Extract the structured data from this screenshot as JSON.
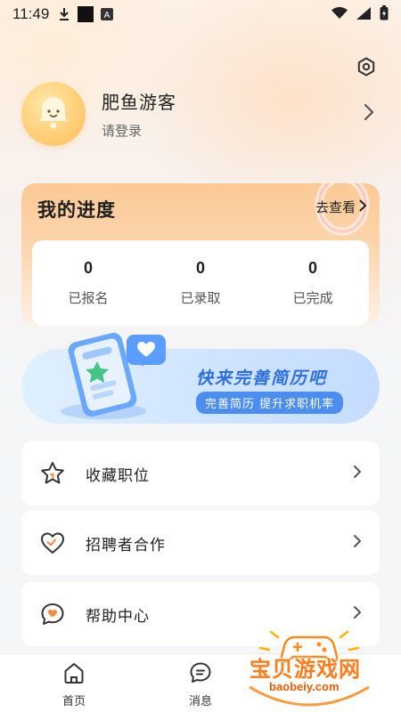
{
  "status_bar": {
    "time": "11:49",
    "icons": [
      "download-icon",
      "media-icon",
      "a-notification-icon",
      "wifi-icon",
      "signal-icon",
      "battery-icon"
    ]
  },
  "profile": {
    "name": "肥鱼游客",
    "subtitle": "请登录",
    "avatar_icon": "bell-icon"
  },
  "progress": {
    "title": "我的进度",
    "link_label": "去查看",
    "stats": [
      {
        "value": "0",
        "label": "已报名"
      },
      {
        "value": "0",
        "label": "已录取"
      },
      {
        "value": "0",
        "label": "已完成"
      }
    ]
  },
  "banner": {
    "title": "快来完善简历吧",
    "subtitle": "完善简历  提升求职机率"
  },
  "menu": [
    {
      "label": "收藏职位",
      "icon": "star-icon"
    },
    {
      "label": "招聘者合作",
      "icon": "heart-icon"
    },
    {
      "label": "帮助中心",
      "icon": "help-chat-icon"
    }
  ],
  "tabs": [
    {
      "label": "首页",
      "icon": "home-icon"
    },
    {
      "label": "消息",
      "icon": "message-icon"
    }
  ],
  "watermark": {
    "title": "宝贝游戏网",
    "url": "baobeiy.com"
  },
  "colors": {
    "accent_orange": "#fbc996",
    "banner_blue": "#2c6fe0",
    "text_dark": "#222222"
  }
}
